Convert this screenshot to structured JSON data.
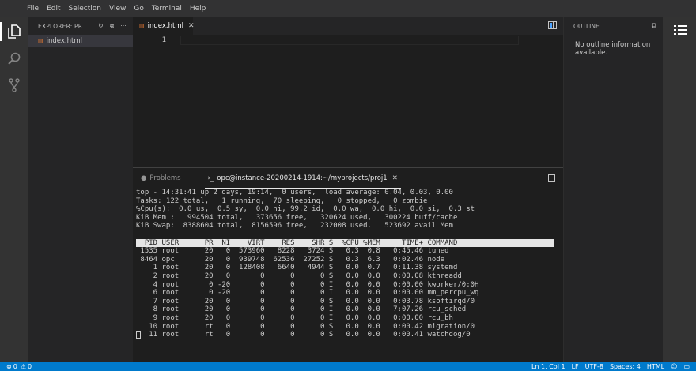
{
  "menu": [
    "File",
    "Edit",
    "Selection",
    "View",
    "Go",
    "Terminal",
    "Help"
  ],
  "activity": [
    "files-icon",
    "search-icon",
    "source-control-icon"
  ],
  "sidebar": {
    "title": "EXPLORER: PR...",
    "files": [
      {
        "name": "index.html",
        "icon": "html-file-icon"
      }
    ]
  },
  "editor": {
    "tab": "index.html",
    "line_number": "1"
  },
  "outline": {
    "title": "OUTLINE",
    "message": "No outline information available."
  },
  "panel": {
    "tabs": [
      "Problems",
      "opc@instance-20200214-1914:~/myprojects/proj1"
    ]
  },
  "terminal": {
    "summary": [
      "top - 14:31:41 up 2 days, 19:14,  0 users,  load average: 0.04, 0.03, 0.00",
      "Tasks: 122 total,   1 running,  70 sleeping,   0 stopped,   0 zombie",
      "%Cpu(s):  0.0 us,  0.5 sy,  0.0 ni, 99.2 id,  0.0 wa,  0.0 hi,  0.0 si,  0.3 st",
      "KiB Mem :   994504 total,   373656 free,   320624 used,   300224 buff/cache",
      "KiB Swap:  8388604 total,  8156596 free,   232008 used.   523692 avail Mem"
    ],
    "header": "  PID USER      PR  NI    VIRT    RES    SHR S  %CPU %MEM     TIME+ COMMAND",
    "rows": [
      " 1535 root      20   0  573960   8228   3724 S   0.3  0.8   0:45.46 tuned",
      " 8464 opc       20   0  939748  62536  27252 S   0.3  6.3   0:02.46 node",
      "    1 root      20   0  128408   6640   4944 S   0.0  0.7   0:11.38 systemd",
      "    2 root      20   0       0      0      0 S   0.0  0.0   0:00.08 kthreadd",
      "    4 root       0 -20       0      0      0 I   0.0  0.0   0:00.00 kworker/0:0H",
      "    6 root       0 -20       0      0      0 I   0.0  0.0   0:00.00 mm_percpu_wq",
      "    7 root      20   0       0      0      0 S   0.0  0.0   0:03.78 ksoftirqd/0",
      "    8 root      20   0       0      0      0 I   0.0  0.0   7:07.26 rcu_sched",
      "    9 root      20   0       0      0      0 I   0.0  0.0   0:00.00 rcu_bh",
      "   10 root      rt   0       0      0      0 S   0.0  0.0   0:00.42 migration/0",
      "   11 root      rt   0       0      0      0 S   0.0  0.0   0:00.41 watchdog/0"
    ]
  },
  "status": {
    "errors": "0",
    "warnings": "0",
    "position": "Ln 1, Col 1",
    "eol": "LF",
    "encoding": "UTF-8",
    "spaces": "Spaces: 4",
    "language": "HTML"
  },
  "colors": {
    "accent": "#007acc",
    "html_icon": "#e37933"
  }
}
